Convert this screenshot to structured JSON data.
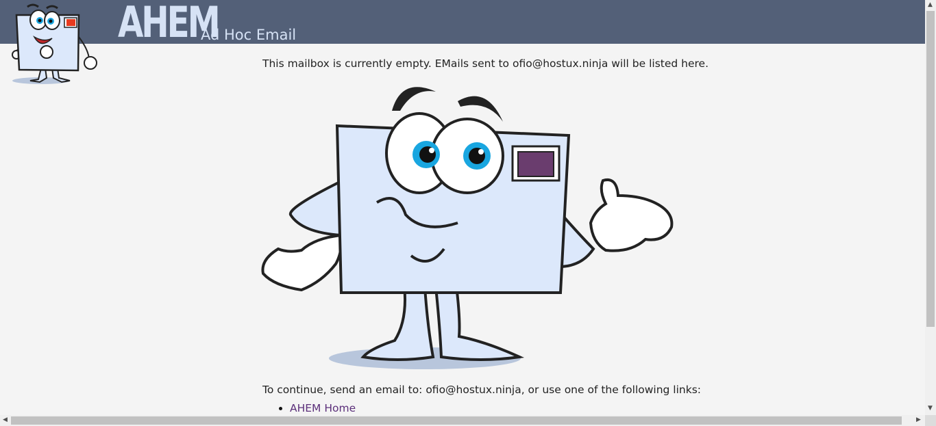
{
  "header": {
    "logo_text": "AHEM",
    "subtitle": "Ad Hoc Email"
  },
  "main": {
    "empty_message": "This mailbox is currently empty. EMails sent to ofio@hostux.ninja will be listed here.",
    "continue_text": "To continue, send an email to: ofio@hostux.ninja, or use one of the following links:",
    "links": [
      {
        "label": "AHEM Home"
      }
    ]
  },
  "colors": {
    "header_bg": "#536078",
    "envelope": "#dce8fb",
    "stamp": "#6a3d6e",
    "link": "#5b2f7a"
  },
  "icons": {
    "mascot": "envelope-mascot-icon",
    "scroll_up": "arrow-up-icon",
    "scroll_down": "arrow-down-icon",
    "scroll_left": "arrow-left-icon",
    "scroll_right": "arrow-right-icon"
  }
}
